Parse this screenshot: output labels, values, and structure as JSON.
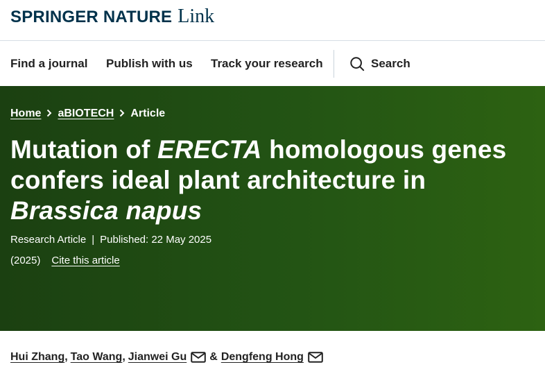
{
  "brand": {
    "name": "SPRINGER NATURE",
    "product": "Link"
  },
  "nav": {
    "items": [
      {
        "label": "Find a journal"
      },
      {
        "label": "Publish with us"
      },
      {
        "label": "Track your research"
      }
    ],
    "search_label": "Search"
  },
  "breadcrumb": {
    "home": "Home",
    "journal": "aBIOTECH",
    "current": "Article"
  },
  "article": {
    "title_part1": "Mutation of ",
    "title_italic1": "ERECTA",
    "title_part2": " homologous genes confers ideal plant architecture in ",
    "title_italic2": "Brassica napus",
    "type": "Research Article",
    "published": "Published: 22 May 2025",
    "year": "(2025)",
    "cite_label": "Cite this article"
  },
  "authors": {
    "list": [
      "Hui Zhang",
      "Tao Wang",
      "Jianwei Gu",
      "Dengfeng Hong"
    ],
    "separator": ",",
    "conjunction": "&"
  },
  "colors": {
    "brand": "#01324b",
    "hero_start": "#1b4011",
    "hero_end": "#2d6212"
  },
  "icons": [
    "search-icon",
    "chevron-right-icon",
    "envelope-icon"
  ]
}
